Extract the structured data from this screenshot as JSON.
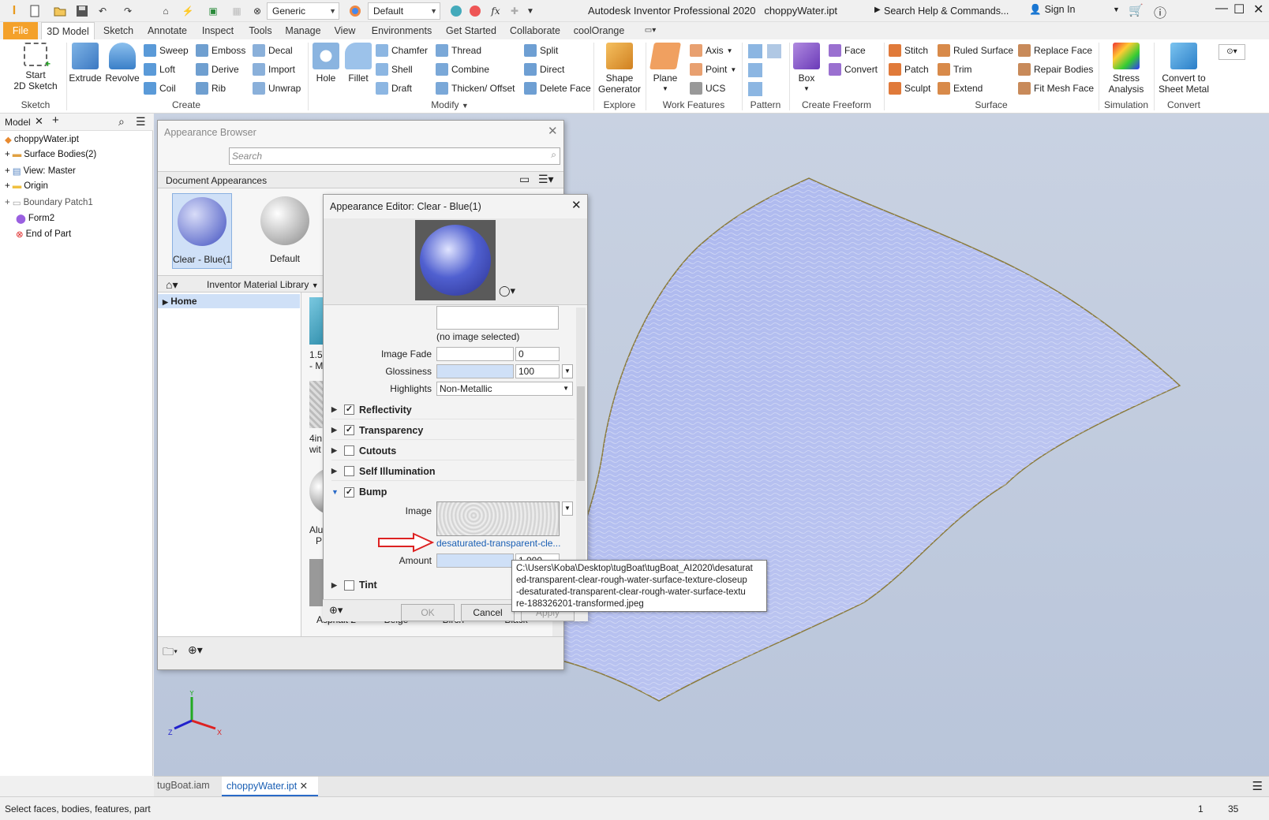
{
  "titlebar": {
    "title": "Autodesk Inventor Professional 2020",
    "filename": "choppyWater.ipt",
    "search_placeholder": "Search Help & Commands...",
    "sign_in": "Sign In",
    "style_combo": "Generic",
    "appearance_combo": "Default"
  },
  "tabs": [
    "File",
    "3D Model",
    "Sketch",
    "Annotate",
    "Inspect",
    "Tools",
    "Manage",
    "View",
    "Environments",
    "Get Started",
    "Collaborate",
    "coolOrange"
  ],
  "ribbon": {
    "sketch": {
      "start": "Start",
      "sketch2d": "2D Sketch",
      "panel": "Sketch"
    },
    "create": {
      "extrude": "Extrude",
      "revolve": "Revolve",
      "sweep": "Sweep",
      "loft": "Loft",
      "coil": "Coil",
      "emboss": "Emboss",
      "derive": "Derive",
      "rib": "Rib",
      "decal": "Decal",
      "import": "Import",
      "unwrap": "Unwrap",
      "panel": "Create"
    },
    "modify": {
      "hole": "Hole",
      "fillet": "Fillet",
      "chamfer": "Chamfer",
      "shell": "Shell",
      "draft": "Draft",
      "thread": "Thread",
      "combine": "Combine",
      "thicken": "Thicken/ Offset",
      "split": "Split",
      "direct": "Direct",
      "delete_face": "Delete Face",
      "panel": "Modify"
    },
    "explore": {
      "shape": "Shape",
      "generator": "Generator",
      "panel": "Explore"
    },
    "work": {
      "plane": "Plane",
      "axis": "Axis",
      "point": "Point",
      "ucs": "UCS",
      "panel": "Work Features"
    },
    "pattern": {
      "panel": "Pattern"
    },
    "freeform": {
      "box": "Box",
      "face": "Face",
      "convert": "Convert",
      "panel": "Create Freeform"
    },
    "surface": {
      "stitch": "Stitch",
      "patch": "Patch",
      "sculpt": "Sculpt",
      "ruled": "Ruled Surface",
      "trim": "Trim",
      "extend": "Extend",
      "replace": "Replace Face",
      "repair": "Repair Bodies",
      "fitmesh": "Fit Mesh Face",
      "panel": "Surface"
    },
    "simulation": {
      "stress": "Stress",
      "analysis": "Analysis",
      "panel": "Simulation"
    },
    "convert": {
      "c1": "Convert to",
      "c2": "Sheet Metal",
      "panel": "Convert"
    }
  },
  "model": {
    "header": "Model",
    "items": [
      "choppyWater.ipt",
      "Surface Bodies(2)",
      "View: Master",
      "Origin",
      "Boundary Patch1",
      "Form2",
      "End of Part"
    ]
  },
  "appearance_browser": {
    "title": "Appearance Browser",
    "search_placeholder": "Search",
    "doc_crumb": "Document Appearances",
    "doc_items": [
      "Clear - Blue(1)",
      "Default"
    ],
    "library": "Inventor Material Library",
    "home": "Home",
    "partial_labels": [
      "1.5",
      "- M",
      "4in",
      "wit",
      "Alu",
      "P"
    ],
    "bottom_items": [
      "Asphalt 2",
      "Beige",
      "Birch - Natu...shed",
      "Black"
    ]
  },
  "editor": {
    "title": "Appearance Editor: Clear - Blue(1)",
    "no_image": "(no image selected)",
    "image_fade_label": "Image Fade",
    "image_fade_value": "0",
    "glossiness_label": "Glossiness",
    "glossiness_value": "100",
    "highlights_label": "Highlights",
    "highlights_value": "Non-Metallic",
    "sections": [
      {
        "name": "Reflectivity",
        "checked": true
      },
      {
        "name": "Transparency",
        "checked": true
      },
      {
        "name": "Cutouts",
        "checked": false
      },
      {
        "name": "Self Illumination",
        "checked": false
      },
      {
        "name": "Bump",
        "checked": true
      },
      {
        "name": "Tint",
        "checked": false
      }
    ],
    "bump_image_label": "Image",
    "bump_link": "desaturated-transparent-cle...",
    "amount_label": "Amount",
    "amount_value": "1.000",
    "ok": "OK",
    "cancel": "Cancel",
    "apply": "Apply"
  },
  "tooltip": {
    "lines": [
      "C:\\Users\\Koba\\Desktop\\tugBoat\\tugBoat_AI2020\\desaturat",
      "ed-transparent-clear-rough-water-surface-texture-closeup",
      "-desaturated-transparent-clear-rough-water-surface-textu",
      "re-188326201-transformed.jpeg"
    ]
  },
  "doctabs": [
    "tugBoat.iam",
    "choppyWater.ipt"
  ],
  "status": {
    "text": "Select faces, bodies, features, part",
    "n1": "1",
    "n2": "35"
  },
  "colors": {
    "accent": "#f4a12a",
    "link": "#1a5fb4",
    "surface": "#b8c2ef"
  }
}
